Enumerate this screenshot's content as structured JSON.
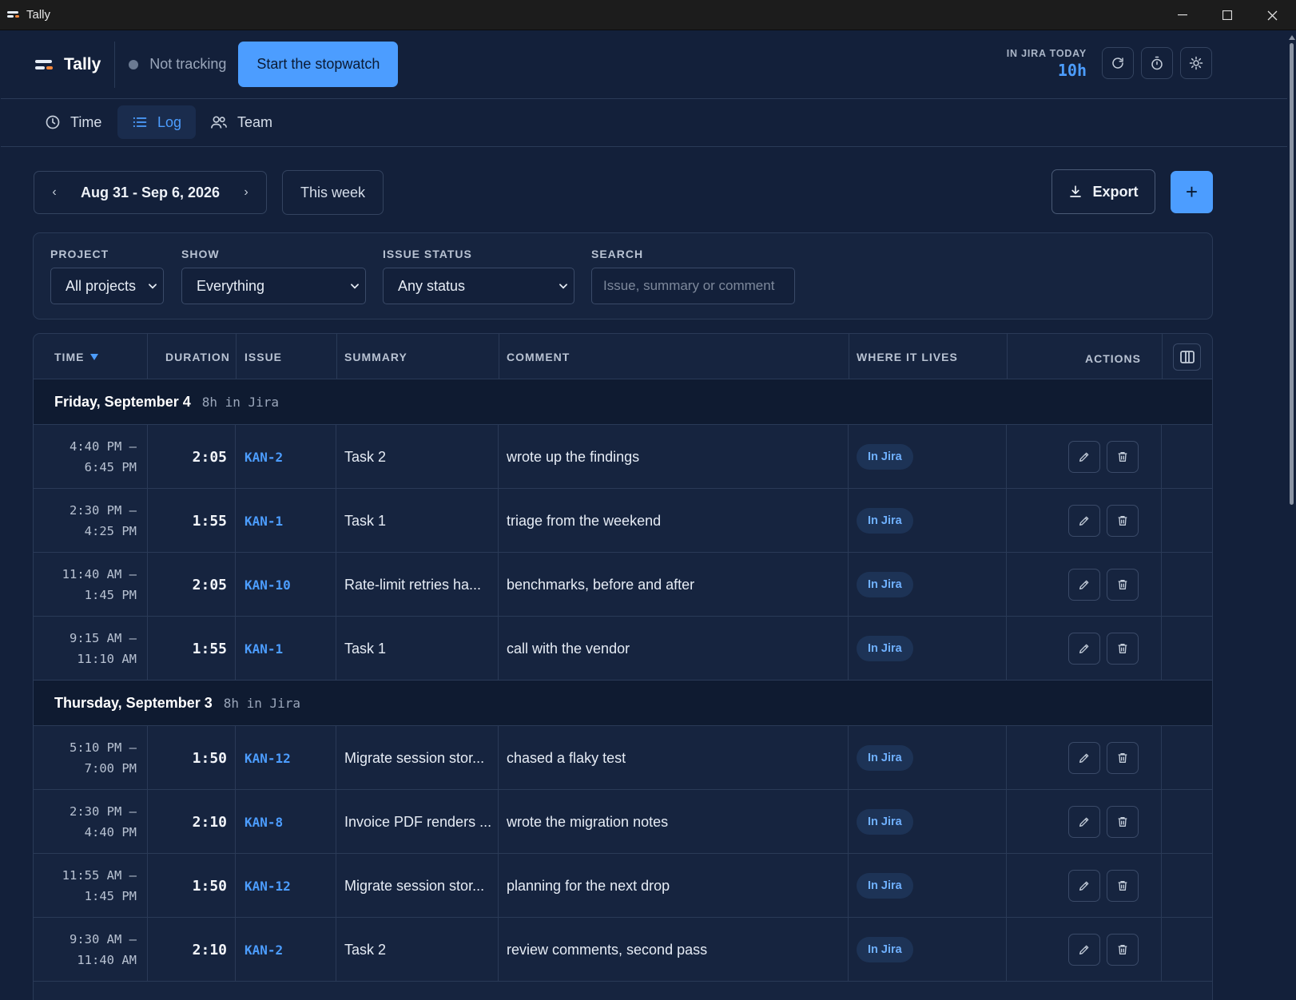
{
  "window": {
    "title": "Tally"
  },
  "header": {
    "brand": "Tally",
    "tracking_status": "Not tracking",
    "start_button": "Start the stopwatch",
    "jira_today_label": "IN JIRA TODAY",
    "jira_today_value": "10h",
    "icons": [
      "refresh-icon",
      "stopwatch-icon",
      "theme-icon"
    ],
    "colors": {
      "accent": "#4c9dff",
      "brand_bar_accent": "#ff8a3d"
    }
  },
  "tabs": [
    {
      "label": "Time",
      "icon": "clock-icon",
      "active": false
    },
    {
      "label": "Log",
      "icon": "list-icon",
      "active": true
    },
    {
      "label": "Team",
      "icon": "users-icon",
      "active": false
    }
  ],
  "toolbar": {
    "date_range": "Aug 31 - Sep 6, 2026",
    "this_week": "This week",
    "export": "Export",
    "add": "+"
  },
  "filters": {
    "project": {
      "label": "PROJECT",
      "value": "All projects"
    },
    "show": {
      "label": "SHOW",
      "value": "Everything"
    },
    "status": {
      "label": "ISSUE STATUS",
      "value": "Any status"
    },
    "search": {
      "label": "SEARCH",
      "placeholder": "Issue, summary or comment"
    }
  },
  "table": {
    "columns": {
      "time": "TIME",
      "duration": "DURATION",
      "issue": "ISSUE",
      "summary": "SUMMARY",
      "comment": "COMMENT",
      "where": "WHERE IT LIVES",
      "actions": "ACTIONS"
    },
    "sort": {
      "column": "time",
      "direction": "desc"
    },
    "groups": [
      {
        "day": "Friday, September 4",
        "summary": "8h in Jira",
        "rows": [
          {
            "start": "4:40 PM –",
            "end": "6:45 PM",
            "duration": "2:05",
            "issue": "KAN-2",
            "summary": "Task 2",
            "comment": "wrote up the findings",
            "where": "In Jira"
          },
          {
            "start": "2:30 PM –",
            "end": "4:25 PM",
            "duration": "1:55",
            "issue": "KAN-1",
            "summary": "Task 1",
            "comment": "triage from the weekend",
            "where": "In Jira"
          },
          {
            "start": "11:40 AM –",
            "end": "1:45 PM",
            "duration": "2:05",
            "issue": "KAN-10",
            "summary": "Rate-limit retries ha...",
            "comment": "benchmarks, before and after",
            "where": "In Jira"
          },
          {
            "start": "9:15 AM –",
            "end": "11:10 AM",
            "duration": "1:55",
            "issue": "KAN-1",
            "summary": "Task 1",
            "comment": "call with the vendor",
            "where": "In Jira"
          }
        ]
      },
      {
        "day": "Thursday, September 3",
        "summary": "8h in Jira",
        "rows": [
          {
            "start": "5:10 PM –",
            "end": "7:00 PM",
            "duration": "1:50",
            "issue": "KAN-12",
            "summary": "Migrate session stor...",
            "comment": "chased a flaky test",
            "where": "In Jira"
          },
          {
            "start": "2:30 PM –",
            "end": "4:40 PM",
            "duration": "2:10",
            "issue": "KAN-8",
            "summary": "Invoice PDF renders ...",
            "comment": "wrote the migration notes",
            "where": "In Jira"
          },
          {
            "start": "11:55 AM –",
            "end": "1:45 PM",
            "duration": "1:50",
            "issue": "KAN-12",
            "summary": "Migrate session stor...",
            "comment": "planning for the next drop",
            "where": "In Jira"
          },
          {
            "start": "9:30 AM –",
            "end": "11:40 AM",
            "duration": "2:10",
            "issue": "KAN-2",
            "summary": "Task 2",
            "comment": "review comments, second pass",
            "where": "In Jira"
          }
        ]
      }
    ]
  }
}
